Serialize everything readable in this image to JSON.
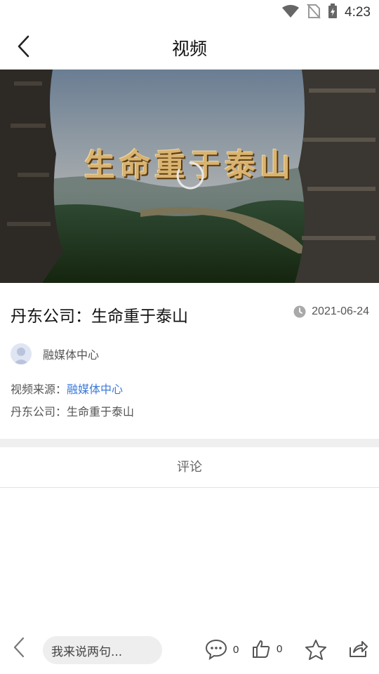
{
  "status_bar": {
    "time": "4:23"
  },
  "nav": {
    "title": "视频"
  },
  "video": {
    "caption": "生命重于泰山"
  },
  "article": {
    "title": "丹东公司：生命重于泰山",
    "date": "2021-06-24",
    "author": "融媒体中心",
    "source_label": "视频来源：",
    "source_value": "融媒体中心",
    "description": "丹东公司：生命重于泰山"
  },
  "comments": {
    "header": "评论"
  },
  "bottom_bar": {
    "input_placeholder": "我来说两句...",
    "comment_count": "0",
    "like_count": "0"
  },
  "colors": {
    "link": "#3b79d8",
    "caption_gold": "#d9b370"
  }
}
